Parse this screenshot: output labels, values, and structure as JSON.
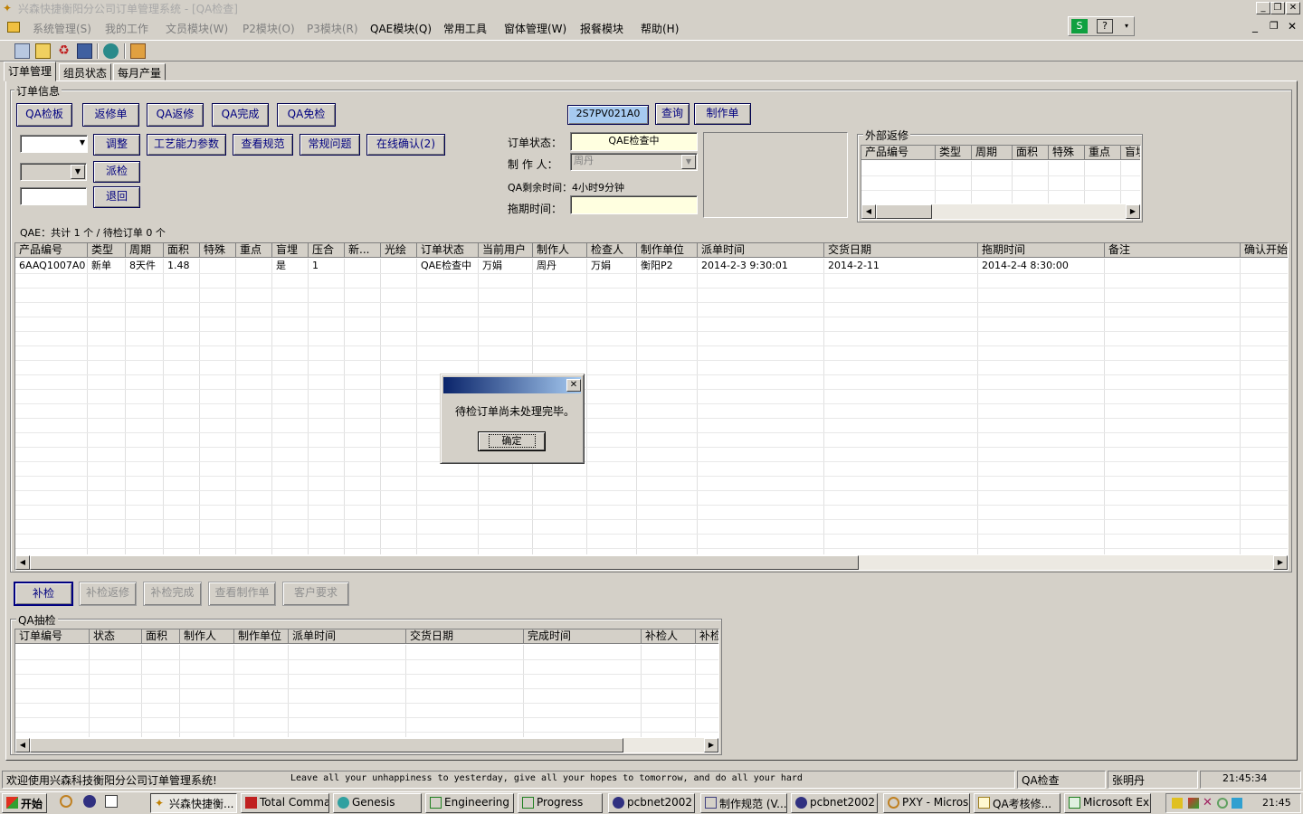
{
  "window": {
    "title": "兴森快捷衡阳分公司订单管理系统 - [QA检查]"
  },
  "menu": [
    "系统管理(S)",
    "我的工作",
    "文员模块(W)",
    "P2模块(O)",
    "P3模块(R)",
    "QAE模块(Q)",
    "常用工具",
    "窗体管理(W)",
    "报餐模块",
    "帮助(H)"
  ],
  "tabs": [
    "订单管理",
    "组员状态",
    "每月产量"
  ],
  "order_info": {
    "group_title": "订单信息",
    "buttons_row1": [
      "QA检板",
      "返修单",
      "QA返修",
      "QA完成",
      "QA免检"
    ],
    "buttons_row2": [
      "调整",
      "工艺能力参数",
      "查看规范",
      "常规问题",
      "在线确认(2)"
    ],
    "dispatch_button": "派检",
    "return_button": "退回",
    "order_code": "2S7PV021A0",
    "query_button": "查询",
    "make_order_button": "制作单",
    "status_label": "订单状态：",
    "status_value": "QAE检查中",
    "maker_label": "制 作 人：",
    "maker_value": "周丹",
    "remaining_label": "QA剩余时间：",
    "remaining_value": "4小时9分钟",
    "delay_label": "拖期时间："
  },
  "external_repair": {
    "title": "外部返修",
    "headers": [
      "产品编号",
      "类型",
      "周期",
      "面积",
      "特殊",
      "重点",
      "盲埋"
    ]
  },
  "qae": {
    "summary": "QAE：共计 1 个 / 待检订单 0 个",
    "headers": [
      "产品编号",
      "类型",
      "周期",
      "面积",
      "特殊",
      "重点",
      "盲埋",
      "压合",
      "新...",
      "光绘",
      "订单状态",
      "当前用户",
      "制作人",
      "检查人",
      "制作单位",
      "派单时间",
      "交货日期",
      "拖期时间",
      "备注",
      "确认开始"
    ],
    "rows": [
      [
        "6AAQ1007A0",
        "新单",
        "8天件",
        "1.48",
        "",
        "",
        "是",
        "1",
        "",
        "",
        "QAE检查中",
        "万娟",
        "周丹",
        "万娟",
        "衡阳P2",
        "2014-2-3 9:30:01",
        "2014-2-11",
        "2014-2-4 8:30:00",
        "",
        ""
      ]
    ]
  },
  "bottom_buttons": [
    "补检",
    "补检返修",
    "补检完成",
    "查看制作单",
    "客户要求"
  ],
  "qa_sampling": {
    "title": "QA抽检",
    "headers": [
      "订单编号",
      "状态",
      "面积",
      "制作人",
      "制作单位",
      "派单时间",
      "交货日期",
      "完成时间",
      "补检人",
      "补检"
    ]
  },
  "dialog": {
    "message": "待检订单尚未处理完毕。",
    "ok": "确定"
  },
  "status": {
    "welcome": "欢迎使用兴森科技衡阳分公司订单管理系统!",
    "marquee": "Leave all your unhappiness to yesterday, give all your hopes to tomorrow, and do all your hard",
    "module": "QA检查",
    "user": "张明丹",
    "time": "21:45:34"
  },
  "taskbar": {
    "start": "开始",
    "tasks": [
      "兴森快捷衡...",
      "Total Comma...",
      "Genesis",
      "Engineering ...",
      "Progress",
      "pcbnet2002",
      "制作规范 (V...",
      "pcbnet2002",
      "PXY - Micros...",
      "QA考核修...",
      "Microsoft Ex..."
    ],
    "clock": "21:45"
  }
}
